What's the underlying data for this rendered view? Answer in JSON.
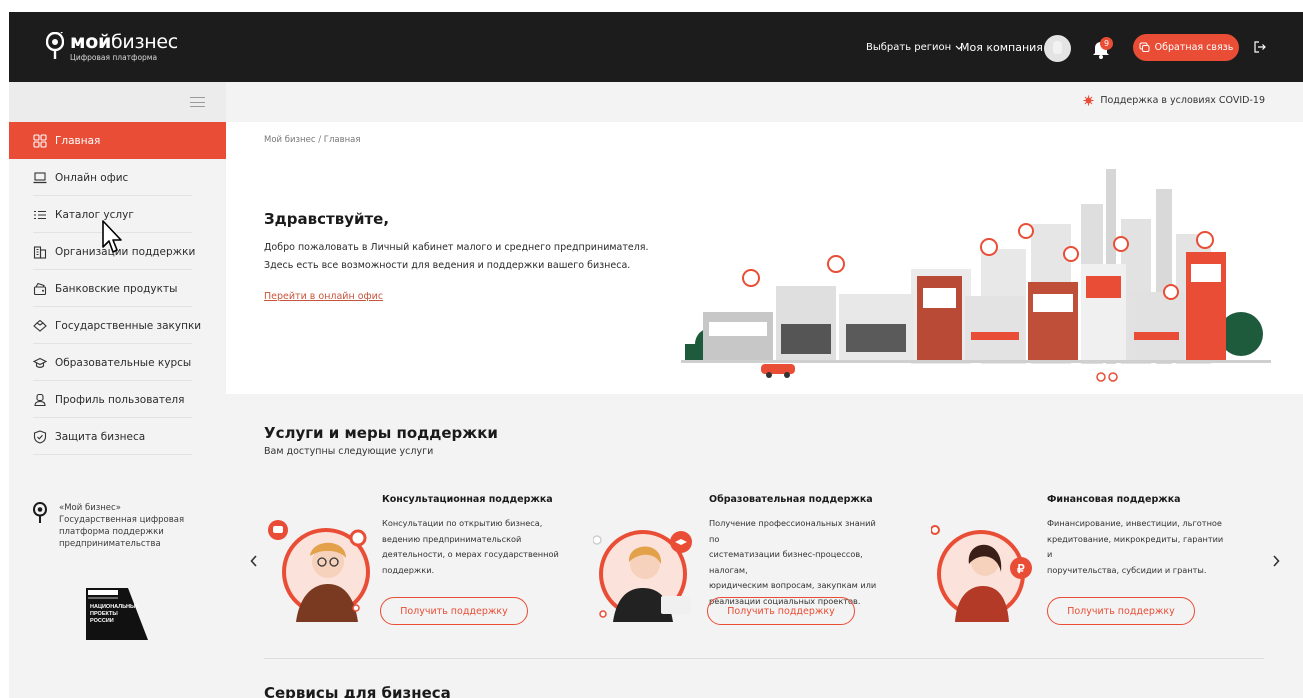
{
  "header": {
    "logo_name_bold": "мой",
    "logo_name_rest": "бизнес",
    "logo_sub": "Цифровая платформа",
    "region_label": "Выбрать регион",
    "company_label": "Моя компания",
    "notifications_count": "9",
    "feedback_label": "Обратная связь"
  },
  "sidebar": {
    "items": [
      {
        "label": "Главная",
        "icon": "grid-icon"
      },
      {
        "label": "Онлайн офис",
        "icon": "laptop-icon"
      },
      {
        "label": "Каталог услуг",
        "icon": "list-icon"
      },
      {
        "label": "Организации поддержки",
        "icon": "building-icon"
      },
      {
        "label": "Банковские продукты",
        "icon": "bank-icon"
      },
      {
        "label": "Государственные закупки",
        "icon": "handshake-icon"
      },
      {
        "label": "Образовательные курсы",
        "icon": "graduation-cap-icon"
      },
      {
        "label": "Профиль пользователя",
        "icon": "user-icon"
      },
      {
        "label": "Защита бизнеса",
        "icon": "shield-icon"
      }
    ],
    "footer_lines": [
      "«Мой бизнес»",
      "Государственная цифровая",
      "платформа поддержки",
      "предпринимательства"
    ],
    "np_logo_lines": [
      "НАЦИОНАЛЬНЫЕ",
      "ПРОЕКТЫ",
      "РОССИИ"
    ]
  },
  "main": {
    "covid_label": "Поддержка в условиях COVID-19",
    "breadcrumb": "Мой бизнес / Главная",
    "hero": {
      "title": "Здравствуйте,",
      "line1": "Добро пожаловать в Личный кабинет малого и среднего предпринимателя.",
      "line2": "Здесь есть все возможности для ведения и поддержки вашего бизнеса.",
      "link": "Перейти в онлайн офис"
    },
    "services": {
      "title": "Услуги и меры поддержки",
      "subtitle": "Вам доступны следующие услуги",
      "cards": [
        {
          "title": "Консультационная поддержка",
          "lines": [
            "Консультации по открытию бизнеса,",
            "ведению предпринимательской",
            "деятельности, о мерах государственной",
            "поддержки."
          ],
          "button": "Получить поддержку"
        },
        {
          "title": "Образовательная поддержка",
          "lines": [
            "Получение профессиональных знаний по",
            "систематизации бизнес-процессов, налогам,",
            "юридическим вопросам, закупкам или",
            "реализации социальных проектов."
          ],
          "button": "Получить поддержку"
        },
        {
          "title": "Финансовая поддержка",
          "lines": [
            "Финансирование, инвестиции, льготное",
            "кредитование, микрокредиты, гарантии и",
            "поручительства, субсидии и гранты."
          ],
          "button": "Получить поддержку"
        }
      ]
    },
    "business_title": "Сервисы для бизнеса"
  },
  "colors": {
    "accent": "#e94d35",
    "header_bg": "#1c1c1c",
    "sidebar_bg": "#f3f3f3"
  }
}
